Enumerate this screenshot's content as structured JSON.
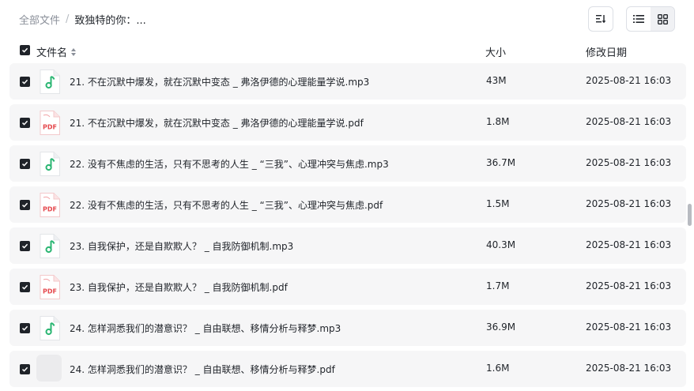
{
  "breadcrumb": {
    "root": "全部文件",
    "separator": "/",
    "current": "致独特的你：..."
  },
  "columns": {
    "name": "文件名",
    "size": "大小",
    "date": "修改日期"
  },
  "files": [
    {
      "name": "21. 不在沉默中爆发，就在沉默中变态 _ 弗洛伊德的心理能量学说.mp3",
      "size": "43M",
      "date": "2025-08-21 16:03",
      "type": "mp3"
    },
    {
      "name": "21. 不在沉默中爆发，就在沉默中变态 _ 弗洛伊德的心理能量学说.pdf",
      "size": "1.8M",
      "date": "2025-08-21 16:03",
      "type": "pdf"
    },
    {
      "name": "22. 没有不焦虑的生活，只有不思考的人生 _ “三我”、心理冲突与焦虑.mp3",
      "size": "36.7M",
      "date": "2025-08-21 16:03",
      "type": "mp3"
    },
    {
      "name": "22. 没有不焦虑的生活，只有不思考的人生 _ “三我”、心理冲突与焦虑.pdf",
      "size": "1.5M",
      "date": "2025-08-21 16:03",
      "type": "pdf"
    },
    {
      "name": "23. 自我保护，还是自欺欺人？ _ 自我防御机制.mp3",
      "size": "40.3M",
      "date": "2025-08-21 16:03",
      "type": "mp3"
    },
    {
      "name": "23. 自我保护，还是自欺欺人？ _ 自我防御机制.pdf",
      "size": "1.7M",
      "date": "2025-08-21 16:03",
      "type": "pdf"
    },
    {
      "name": "24. 怎样洞悉我们的潜意识？ _ 自由联想、移情分析与释梦.mp3",
      "size": "36.9M",
      "date": "2025-08-21 16:03",
      "type": "mp3"
    },
    {
      "name": "24. 怎样洞悉我们的潜意识？ _ 自由联想、移情分析与释梦.pdf",
      "size": "1.6M",
      "date": "2025-08-21 16:03",
      "type": "loading"
    }
  ],
  "icons": {
    "pdf_label": "PDF"
  },
  "colors": {
    "audio_green": "#2bb673",
    "pdf_red": "#e5484d",
    "row_bg": "#f6f6f7"
  }
}
